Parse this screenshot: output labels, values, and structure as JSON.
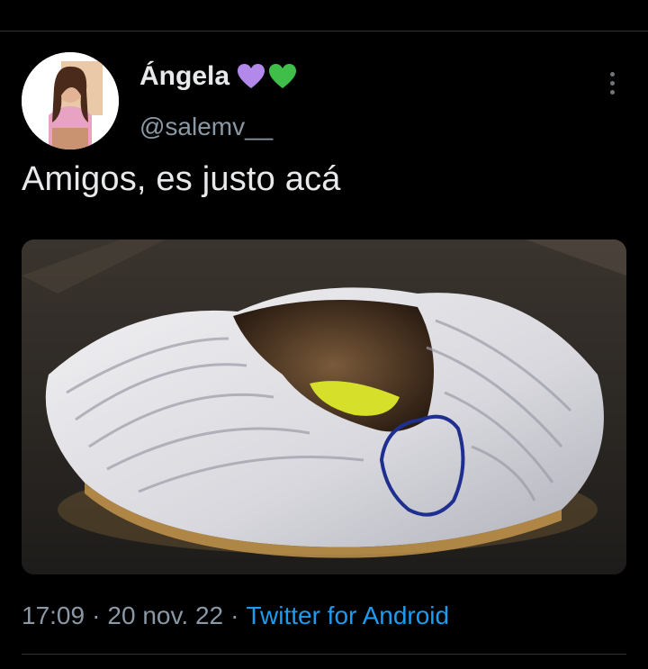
{
  "tweet": {
    "author": {
      "display_name": "Ángela",
      "handle": "@salemv__",
      "emoji": [
        "purple-heart",
        "green-heart"
      ],
      "heart_colors": [
        "#b388eb",
        "#3fbf4a"
      ]
    },
    "text": "Amigos, es justo acá",
    "time": "17:09",
    "date": "20 nov. 22",
    "separator": "·",
    "source": "Twitter for Android"
  },
  "colors": {
    "background": "#000000",
    "text_primary": "#e7e9ea",
    "text_secondary": "#8b98a5",
    "link": "#1d9bf0",
    "annotation_circle": "#1f2f8f"
  }
}
